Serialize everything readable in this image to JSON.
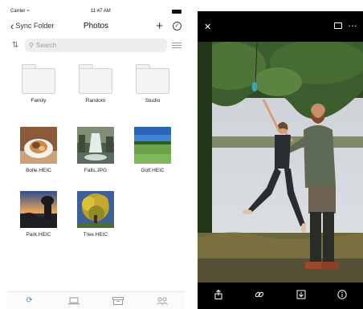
{
  "status_bar": {
    "carrier": "Carrier",
    "time": "11:47 AM"
  },
  "navbar": {
    "back_label": "Sync Folder",
    "title": "Photos"
  },
  "search": {
    "placeholder": "Search"
  },
  "folders": [
    {
      "label": "Family"
    },
    {
      "label": "Random"
    },
    {
      "label": "Studio"
    }
  ],
  "files": [
    {
      "label": "Bolle.HEIC"
    },
    {
      "label": "Falls.JPG"
    },
    {
      "label": "Golf.HEIC"
    },
    {
      "label": "Park.HEIC"
    },
    {
      "label": "Tree.HEIC"
    }
  ],
  "tab_bar": {
    "items": [
      "sync-icon",
      "laptop-icon",
      "archive-icon",
      "people-icon"
    ],
    "active_index": 0
  },
  "viewer": {
    "toolbar_icons": [
      "close-icon",
      "cast-icon",
      "more-icon"
    ],
    "bottom_icons": [
      "share-icon",
      "link-icon",
      "download-icon",
      "info-icon"
    ]
  },
  "colors": {
    "accent": "#3b8fd6",
    "viewer_bg": "#000000"
  }
}
